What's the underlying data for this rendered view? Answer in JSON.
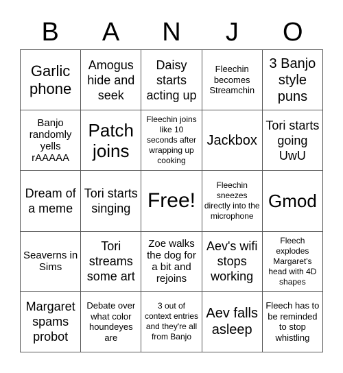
{
  "title_letters": [
    "B",
    "A",
    "N",
    "J",
    "O"
  ],
  "cells": [
    [
      "Garlic phone",
      "Amogus hide and seek",
      "Daisy starts acting up",
      "Fleechin becomes Streamchin",
      "3 Banjo style puns"
    ],
    [
      "Banjo randomly yells rAAAAA",
      "Patch joins",
      "Fleechin joins like 10 seconds after wrapping up cooking",
      "Jackbox",
      "Tori starts going UwU"
    ],
    [
      "Dream of a meme",
      "Tori starts singing",
      "Free!",
      "Fleechin sneezes directly into the microphone",
      "Gmod"
    ],
    [
      "Seaverns in Sims",
      "Tori streams some art",
      "Zoe walks the dog for a bit and rejoins",
      "Aev's wifi stops working",
      "Fleech explodes Margaret's head with 4D shapes"
    ],
    [
      "Margaret spams probot",
      "Debate over what color houndeyes are",
      "3 out of context entries and they're all from Banjo",
      "Aev falls asleep",
      "Fleech has to be reminded to stop whistling"
    ]
  ]
}
